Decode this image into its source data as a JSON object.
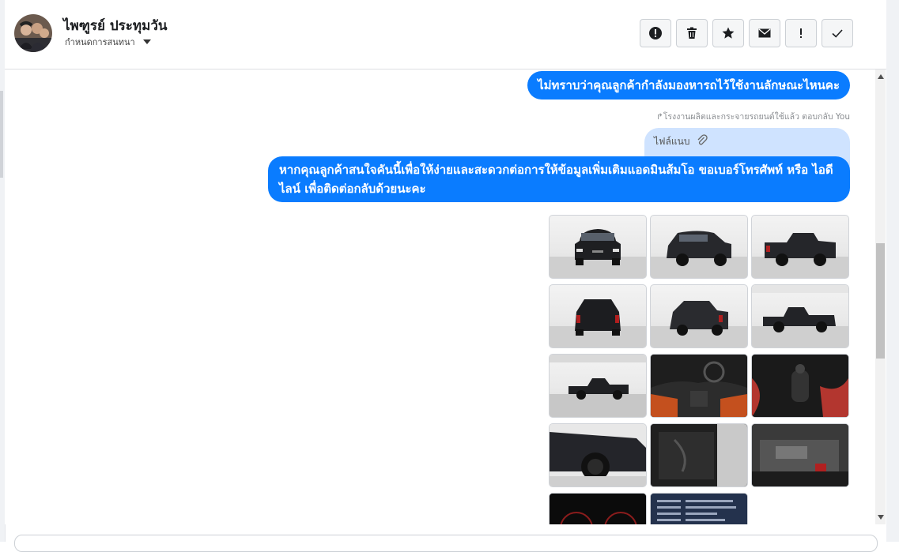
{
  "header": {
    "contact_name": "ไพฑูรย์ ประทุมวัน",
    "conversation_setting": "กำหนดการสนทนา"
  },
  "toolbar": {
    "buttons": [
      {
        "name": "spam",
        "icon": "alert-circle-icon"
      },
      {
        "name": "delete",
        "icon": "trash-icon"
      },
      {
        "name": "star",
        "icon": "star-icon"
      },
      {
        "name": "mark-unread",
        "icon": "envelope-icon"
      },
      {
        "name": "important",
        "icon": "exclamation-icon"
      },
      {
        "name": "mark-done",
        "icon": "check-icon"
      }
    ]
  },
  "messages": {
    "msg1": "ไม่ทราบว่าคุณลูกค้ากำลังมองหารถไว้ใช้งานลักษณะไหนคะ",
    "reply_note": "โรงงานผลิตและกระจายรถยนต์ใช้แล้ว ตอบกลับ You",
    "attachment_label": "ไฟล์แนบ",
    "msg2": "หากคุณลูกค้าสนใจคันนี้เพื่อให้ง่ายและสะดวกต่อการให้ข้อมูลเพิ่มเติมแอดมินส้มโอ ขอเบอร์โทรศัพท์ หรือ ไอดีไลน์ เพื่อติดต่อกลับด้วยนะคะ"
  },
  "photos": {
    "count": 14,
    "items": [
      "pickup-front",
      "pickup-front-3q",
      "pickup-rear-3q",
      "pickup-rear",
      "pickup-rear-3q-left",
      "pickup-side",
      "pickup-side-wide",
      "interior-dashboard",
      "interior-gearshift",
      "wheel-closeup",
      "door-interior",
      "engine-bay",
      "instrument-cluster",
      "registration-document"
    ]
  },
  "colors": {
    "bubble": "#0a7cff",
    "attachment_bg": "#cfe3ff",
    "header_border": "#dddfe2"
  }
}
